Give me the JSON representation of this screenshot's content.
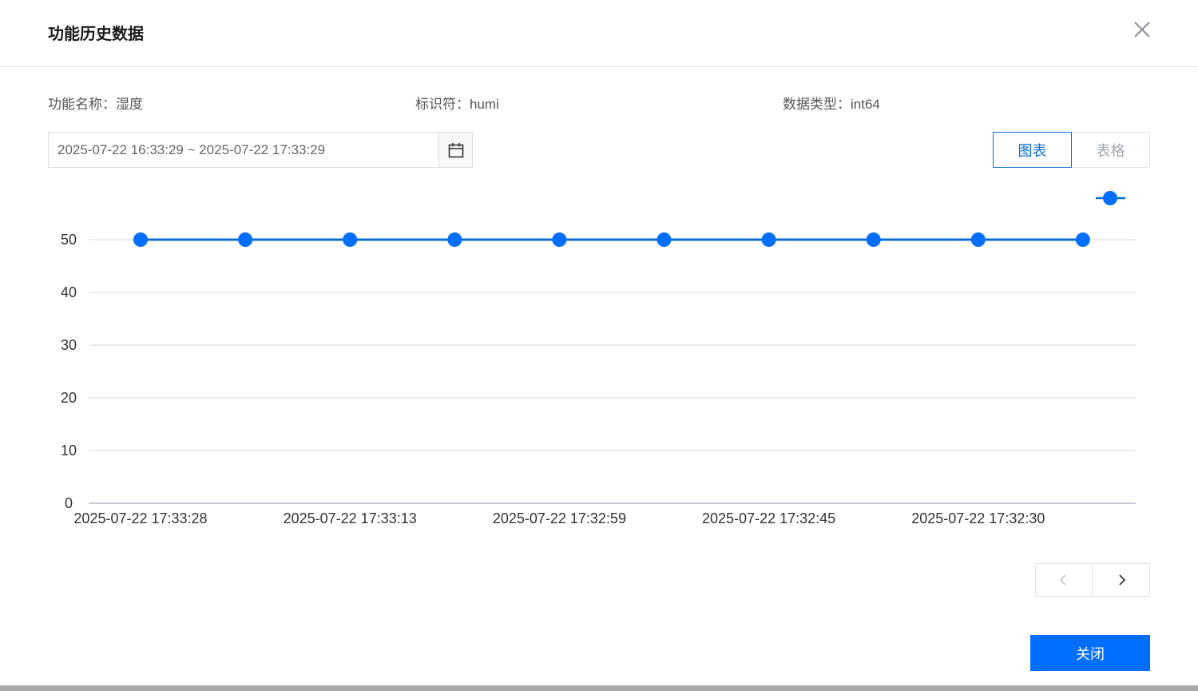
{
  "dialog": {
    "title": "功能历史数据",
    "close_icon": "close-icon"
  },
  "info": {
    "name_label": "功能名称：",
    "name_value": "湿度",
    "id_label": "标识符：",
    "id_value": "humi",
    "type_label": "数据类型：",
    "type_value": "int64"
  },
  "date_range": {
    "value": "2025-07-22 16:33:29 ~ 2025-07-22 17:33:29",
    "icon": "calendar-icon"
  },
  "view_tabs": [
    {
      "label": "图表",
      "active": true
    },
    {
      "label": "表格",
      "active": false
    }
  ],
  "pager": {
    "prev_icon": "chevron-left-icon",
    "next_icon": "chevron-right-icon"
  },
  "footer": {
    "close_label": "关闭"
  },
  "colors": {
    "accent": "#006eff",
    "line": "#0a6ed1",
    "grid": "#e3e5ea"
  },
  "chart_data": {
    "type": "line",
    "x": [
      "2025-07-22 17:33:28",
      "",
      "2025-07-22 17:33:13",
      "",
      "2025-07-22 17:32:59",
      "",
      "2025-07-22 17:32:45",
      "",
      "2025-07-22 17:32:30",
      ""
    ],
    "series": [
      {
        "values": [
          50,
          50,
          50,
          50,
          50,
          50,
          50,
          50,
          50,
          50
        ]
      }
    ],
    "y_ticks": [
      "0",
      "10",
      "20",
      "30",
      "40",
      "50"
    ],
    "ylim": [
      0,
      50
    ],
    "grid": true,
    "legend": "top-right",
    "title": "",
    "xlabel": "",
    "ylabel": ""
  }
}
